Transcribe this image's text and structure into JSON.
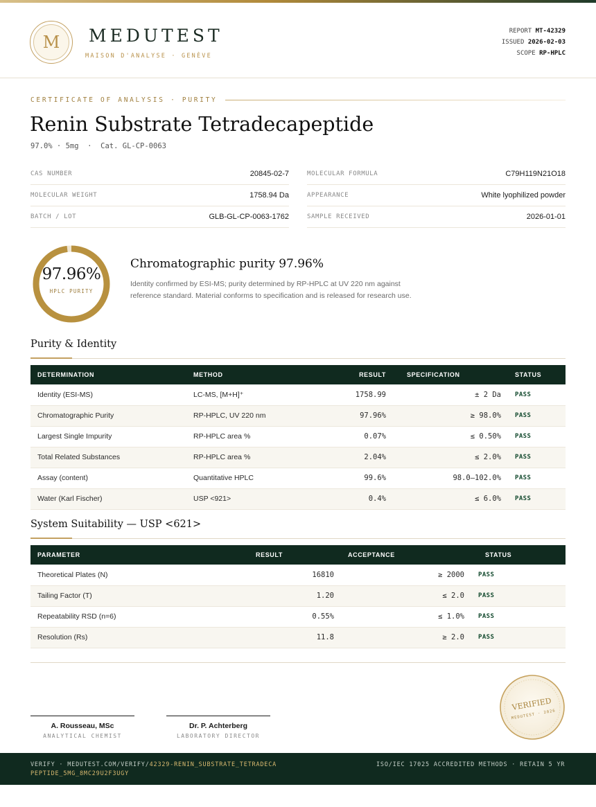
{
  "header": {
    "logo_letter": "M",
    "brand": "MEDUTEST",
    "tagline": "MAISON D'ANALYSE · GENÈVE",
    "report_label": "REPORT",
    "report_value": "MT-42329",
    "issued_label": "ISSUED",
    "issued_value": "2026-02-03",
    "scope_label": "SCOPE",
    "scope_value": "RP-HPLC"
  },
  "certificate": {
    "kicker": "CERTIFICATE OF ANALYSIS · PURITY",
    "title": "Renin Substrate Tetradecapeptide",
    "subtitle": "97.0% · 5mg  ·  Cat. GL-CP-0063"
  },
  "properties": {
    "left": [
      {
        "label": "CAS NUMBER",
        "value": "20845-02-7"
      },
      {
        "label": "MOLECULAR WEIGHT",
        "value": "1758.94 Da"
      },
      {
        "label": "BATCH / LOT",
        "value": "GLB-GL-CP-0063-1762"
      }
    ],
    "right": [
      {
        "label": "MOLECULAR FORMULA",
        "value": "C79H119N21O18"
      },
      {
        "label": "APPEARANCE",
        "value": "White lyophilized powder"
      },
      {
        "label": "SAMPLE RECEIVED",
        "value": "2026-01-01"
      }
    ]
  },
  "purity": {
    "value": "97.96%",
    "label": "HPLC PURITY",
    "fraction": 0.9796,
    "ring_color": "#b8913f",
    "headline": "Chromatographic purity 97.96%",
    "text": "Identity confirmed by ESI-MS; purity determined by RP-HPLC at UV 220 nm against reference standard. Material conforms to specification and is released for research use."
  },
  "purity_table": {
    "section_title": "Purity & Identity",
    "headers": [
      "DETERMINATION",
      "METHOD",
      "RESULT",
      "SPECIFICATION",
      "STATUS"
    ],
    "rows": [
      {
        "determination": "Identity (ESI-MS)",
        "method": "LC-MS, [M+H]⁺",
        "result": "1758.99",
        "spec": "± 2 Da",
        "status": "PASS"
      },
      {
        "determination": "Chromatographic Purity",
        "method": "RP-HPLC, UV 220 nm",
        "result": "97.96%",
        "spec": "≥ 98.0%",
        "status": "PASS"
      },
      {
        "determination": "Largest Single Impurity",
        "method": "RP-HPLC area %",
        "result": "0.07%",
        "spec": "≤ 0.50%",
        "status": "PASS"
      },
      {
        "determination": "Total Related Substances",
        "method": "RP-HPLC area %",
        "result": "2.04%",
        "spec": "≤ 2.0%",
        "status": "PASS"
      },
      {
        "determination": "Assay (content)",
        "method": "Quantitative HPLC",
        "result": "99.6%",
        "spec": "98.0–102.0%",
        "status": "PASS"
      },
      {
        "determination": "Water (Karl Fischer)",
        "method": "USP <921>",
        "result": "0.4%",
        "spec": "≤ 6.0%",
        "status": "PASS"
      }
    ]
  },
  "suitability_table": {
    "section_title": "System Suitability — USP <621>",
    "headers": [
      "PARAMETER",
      "RESULT",
      "ACCEPTANCE",
      "STATUS"
    ],
    "rows": [
      {
        "parameter": "Theoretical Plates (N)",
        "result": "16810",
        "acceptance": "≥ 2000",
        "status": "PASS"
      },
      {
        "parameter": "Tailing Factor (T)",
        "result": "1.20",
        "acceptance": "≤ 2.0",
        "status": "PASS"
      },
      {
        "parameter": "Repeatability RSD (n=6)",
        "result": "0.55%",
        "acceptance": "≤ 1.0%",
        "status": "PASS"
      },
      {
        "parameter": "Resolution (Rs)",
        "result": "11.8",
        "acceptance": "≥ 2.0",
        "status": "PASS"
      }
    ]
  },
  "signatures": [
    {
      "name": "A. Rousseau, MSc",
      "role": "ANALYTICAL CHEMIST"
    },
    {
      "name": "Dr. P. Achterberg",
      "role": "LABORATORY DIRECTOR"
    }
  ],
  "seal": {
    "text": "VERIFIED",
    "subtext": "MEDUTEST · 2026"
  },
  "footer": {
    "verify_prefix": "VERIFY · MEDUTEST.COM/VERIFY/",
    "verify_code": "42329-RENIN_SUBSTRATE_TETRADECAPEPTIDE_5MG_8MC29U2F3UGY",
    "right": "ISO/IEC 17025 ACCREDITED METHODS · RETAIN 5 YR"
  }
}
